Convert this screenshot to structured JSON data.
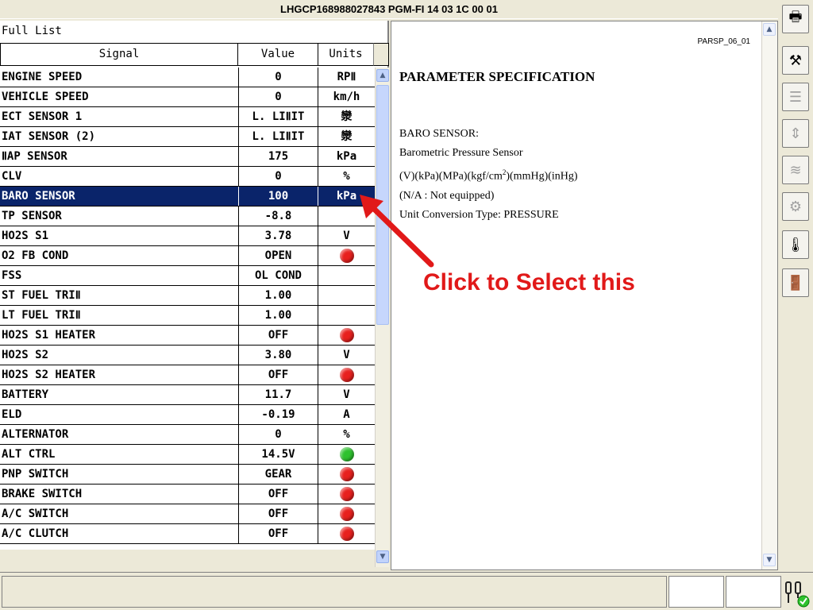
{
  "window": {
    "title": "LHGCP168988027843  PGM-FI  14 03 1C 00 01"
  },
  "list": {
    "caption": "Full List",
    "headers": {
      "signal": "Signal",
      "value": "Value",
      "units": "Units"
    },
    "rows": [
      {
        "signal": "ENGINE SPEED",
        "value": "0",
        "units": "RPⅡ"
      },
      {
        "signal": "VEHICLE SPEED",
        "value": "0",
        "units": "km/h"
      },
      {
        "signal": "ECT SENSOR 1",
        "value": "L. LIⅡIT",
        "units": "灓"
      },
      {
        "signal": "IAT SENSOR (2)",
        "value": "L. LIⅡIT",
        "units": "灓"
      },
      {
        "signal": "ⅡAP SENSOR",
        "value": "175",
        "units": "kPa"
      },
      {
        "signal": "CLV",
        "value": "0",
        "units": "%"
      },
      {
        "signal": "BARO SENSOR",
        "value": "100",
        "units": "kPa",
        "selected": true
      },
      {
        "signal": "TP SENSOR",
        "value": "-8.8",
        "units": ""
      },
      {
        "signal": "HO2S S1",
        "value": "3.78",
        "units": "V"
      },
      {
        "signal": "O2 FB COND",
        "value": "OPEN",
        "indicator": "red"
      },
      {
        "signal": "FSS",
        "value": "OL COND",
        "units": ""
      },
      {
        "signal": "ST FUEL TRIⅡ",
        "value": "1.00",
        "units": ""
      },
      {
        "signal": "LT FUEL TRIⅡ",
        "value": "1.00",
        "units": ""
      },
      {
        "signal": "HO2S S1 HEATER",
        "value": "OFF",
        "indicator": "red"
      },
      {
        "signal": "HO2S S2",
        "value": "3.80",
        "units": "V"
      },
      {
        "signal": "HO2S S2 HEATER",
        "value": "OFF",
        "indicator": "red"
      },
      {
        "signal": "BATTERY",
        "value": "11.7",
        "units": "V"
      },
      {
        "signal": "ELD",
        "value": "-0.19",
        "units": "A"
      },
      {
        "signal": "ALTERNATOR",
        "value": "0",
        "units": "%"
      },
      {
        "signal": "ALT CTRL",
        "value": "14.5V",
        "indicator": "green"
      },
      {
        "signal": "PNP SWITCH",
        "value": "GEAR",
        "indicator": "red"
      },
      {
        "signal": "BRAKE SWITCH",
        "value": "OFF",
        "indicator": "red"
      },
      {
        "signal": "A/C SWITCH",
        "value": "OFF",
        "indicator": "red"
      },
      {
        "signal": "A/C CLUTCH",
        "value": "OFF",
        "indicator": "red"
      }
    ]
  },
  "info": {
    "code": "PARSP_06_01",
    "title": "PARAMETER SPECIFICATION",
    "line1": "BARO SENSOR:",
    "line2": "Barometric Pressure Sensor",
    "line3_pre": "(V)(kPa)(MPa)(kgf/cm",
    "line3_sup": "2",
    "line3_post": ")(mmHg)(inHg)",
    "line4": "(N/A : Not equipped)",
    "line5": "Unit Conversion Type: PRESSURE"
  },
  "callout": {
    "text": "Click to Select this",
    "color": "#e11919"
  },
  "colors": {
    "selection": "#0a246a",
    "indicator_red": "#e8201e",
    "indicator_green": "#2ec22e"
  },
  "toolbar": {
    "buttons": [
      {
        "name": "print-icon",
        "glyph": "🖶",
        "enabled": true
      },
      {
        "name": "tools-icon",
        "glyph": "⚒",
        "enabled": true
      },
      {
        "name": "list-icon",
        "glyph": "☰",
        "enabled": false
      },
      {
        "name": "updown-icon",
        "glyph": "⇕",
        "enabled": false
      },
      {
        "name": "graph-icon",
        "glyph": "≋",
        "enabled": false
      },
      {
        "name": "snapshot-icon",
        "glyph": "⚙",
        "enabled": false
      },
      {
        "name": "thermometer-icon",
        "glyph": "🌡",
        "enabled": true
      },
      {
        "name": "exit-icon",
        "glyph": "🚪",
        "enabled": true
      }
    ]
  }
}
